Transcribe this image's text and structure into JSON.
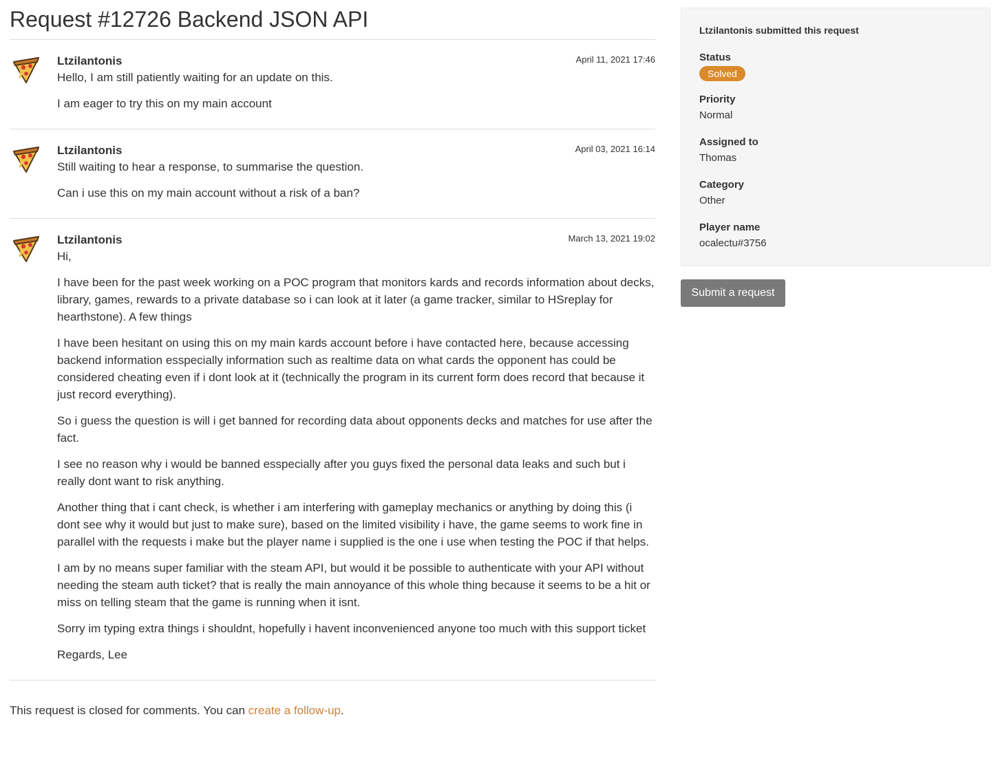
{
  "page": {
    "title": "Request #12726 Backend JSON API"
  },
  "comments": [
    {
      "author": "Ltzilantonis",
      "date": "April 11, 2021 17:46",
      "avatar_icon": "pizza-slice-icon",
      "paragraphs": [
        "Hello, I am still patiently waiting for an update on this.",
        "I am eager to try this on my main account"
      ]
    },
    {
      "author": "Ltzilantonis",
      "date": "April 03, 2021 16:14",
      "avatar_icon": "pizza-slice-icon",
      "paragraphs": [
        "Still waiting to hear a response, to summarise the question.",
        "Can i use this on my main account without a risk of a ban?"
      ]
    },
    {
      "author": "Ltzilantonis",
      "date": "March 13, 2021 19:02",
      "avatar_icon": "pizza-slice-icon",
      "paragraphs": [
        "Hi,",
        "I have been for the past week working on a POC program that monitors kards and records information about decks, library, games, rewards to a private database so i can look at it later (a game tracker, similar to HSreplay for hearthstone). A few things",
        "I have been hesitant on using this on my main kards account before i have contacted here, because accessing backend information esspecially information such as realtime data on what cards the opponent has could be considered cheating even if i dont look at it (technically the program in its current form does record that because it just record everything).",
        "So i guess the question is will i get banned for recording data about opponents decks and matches for use after the fact.",
        "I see no reason why i would be banned esspecially after you guys fixed the personal data leaks and such but i really dont want to risk anything.",
        "Another thing that i cant check, is whether i am interfering with gameplay mechanics or anything by doing this (i dont see why it would but just to make sure), based on the limited visibility i have, the game seems to work fine in parallel with the requests i make but the player name i supplied is the one i use when testing the POC if that helps.",
        "I am by no means super familiar with the steam API, but would it be possible to authenticate with your API without needing the steam auth ticket? that is really the main annoyance of this whole thing because it seems to be a hit or miss on telling steam that the game is running when it isnt.",
        "Sorry im typing extra things i shouldnt, hopefully i havent inconvenienced anyone too much with this support ticket",
        "Regards, Lee"
      ]
    }
  ],
  "footer": {
    "closed_text": "This request is closed for comments. You can ",
    "followup_link": "create a follow-up",
    "period": "."
  },
  "sidebar": {
    "submitter_text": "Ltzilantonis submitted this request",
    "status_label": "Status",
    "status_value": "Solved",
    "priority_label": "Priority",
    "priority_value": "Normal",
    "assigned_label": "Assigned to",
    "assigned_value": "Thomas",
    "category_label": "Category",
    "category_value": "Other",
    "player_label": "Player name",
    "player_value": "ocalectu#3756"
  },
  "actions": {
    "submit_request_label": "Submit a request"
  },
  "colors": {
    "status_badge": "#db8a2b",
    "link": "#cf8238",
    "button": "#7a7a7a"
  }
}
